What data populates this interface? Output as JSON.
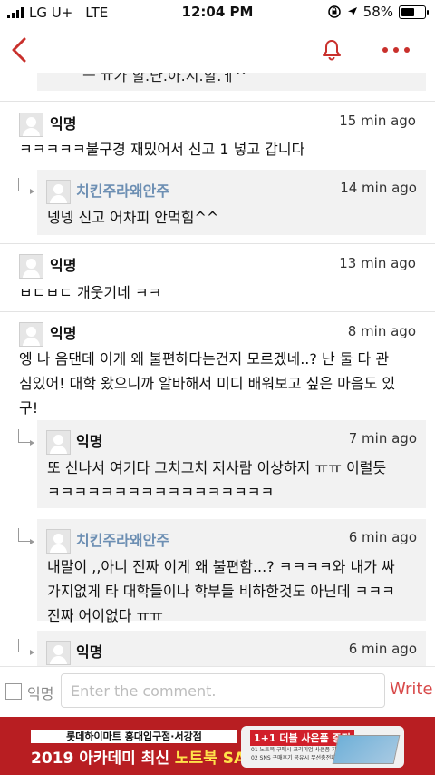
{
  "status_bar": {
    "carrier": "LG U+",
    "network": "LTE",
    "time": "12:04 PM",
    "battery": "58%",
    "battery_level": 0.58
  },
  "nav": {
    "back_icon": "chevron-left-icon",
    "bell_icon": "bell-icon",
    "more_icon": "more-dots-icon",
    "accent_color": "#c9302c"
  },
  "prev_fragment": "ㅡ ㅠ가 할.단.아.시.할.ㅔ^",
  "comments": [
    {
      "name": "익명",
      "time": "15 min ago",
      "text": "ㅋㅋㅋㅋㅋ불구경 재밌어서 신고 1 넣고 갑니다",
      "replies": [
        {
          "name": "치킨주라왜안주",
          "time": "14 min ago",
          "text": "넹넹 신고 어차피 안먹힘^^"
        }
      ]
    },
    {
      "name": "익명",
      "time": "13 min ago",
      "text": "ㅂㄷㅂㄷ 개웃기네 ㅋㅋ",
      "replies": []
    },
    {
      "name": "익명",
      "time": "8 min ago",
      "text_lines": [
        "엥 나 음댄데 이게 왜 불편하다는건지 모르겠네..? 난 둘 다 관",
        "심있어! 대학 왔으니까 알바해서 미디 배워보고 싶은 마음도 있",
        "구!"
      ],
      "replies": [
        {
          "name": "익명",
          "time": "7 min ago",
          "text_lines": [
            "또 신나서 여기다 그치그치 저사람 이상하지 ㅠㅠ 이럴듯",
            "ㅋㅋㅋㅋㅋㅋㅋㅋㅋㅋㅋㅋㅋㅋㅋㅋㅋ"
          ]
        },
        {
          "name": "치킨주라왜안주",
          "time": "6 min ago",
          "text_lines": [
            "내말이 ,,아니 진짜 이게 왜 불편함...? ㅋㅋㅋㅋ와 내가 싸",
            "가지없게 타 대학들이나 학부들 비하한것도 아닌데 ㅋㅋㅋ",
            "진짜 어이없다 ㅠㅠ"
          ]
        },
        {
          "name": "익명",
          "time": "6 min ago"
        }
      ]
    }
  ],
  "composer": {
    "anonymous_label": "익명",
    "placeholder": "Enter the comment.",
    "write_label": "Write"
  },
  "ad": {
    "line1": "롯데하이마트 홍대입구점·서강점",
    "line2_prefix": "2019 아카데미 최신 ",
    "line2_highlight": "노트북 SALE",
    "badge": "1+1 더블 사은품 증정",
    "sub1": "01 노트북 구매시 프리미엄 사은품 지급",
    "sub2": "02 SNS 구매후기 공유시 무선충전패드 추가증정",
    "bg_color": "#b81e22"
  }
}
